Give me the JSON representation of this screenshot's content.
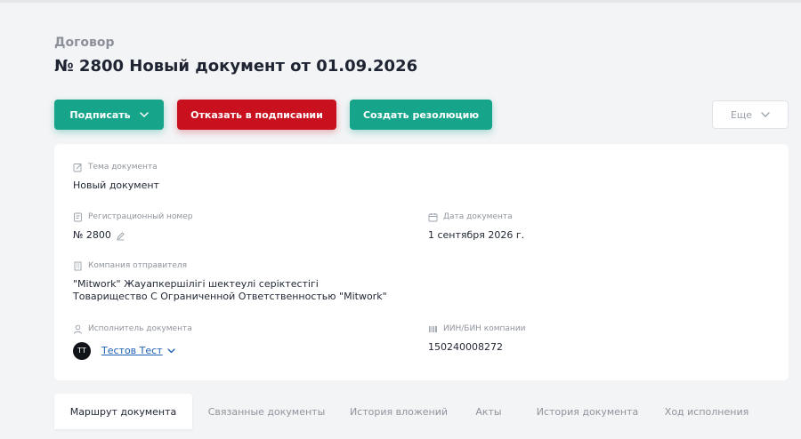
{
  "header": {
    "doc_type": "Договор",
    "title": "№ 2800 Новый документ от 01.09.2026"
  },
  "actions": {
    "sign_label": "Подписать",
    "reject_label": "Отказать в подписании",
    "resolution_label": "Создать резолюцию",
    "more_label": "Еще"
  },
  "details": {
    "subject": {
      "label": "Тема документа",
      "value": "Новый документ",
      "icon": "edit-document-icon"
    },
    "reg_number": {
      "label": "Регистрационный номер",
      "value": "№ 2800",
      "icon": "reg-number-icon"
    },
    "doc_date": {
      "label": "Дата документа",
      "value": "1 сентября 2026 г.",
      "icon": "calendar-icon"
    },
    "sender": {
      "label": "Компания отправителя",
      "value_line1": "\"Mitwork\" Жауапкершілігі шектеулі серіктестігі",
      "value_line2": "Товарищество С Ограниченной Ответственностью \"Mitwork\"",
      "icon": "building-icon"
    },
    "executor": {
      "label": "Исполнитель документа",
      "avatar_initials": "ТТ",
      "name": "Тестов Тест",
      "icon": "user-icon"
    },
    "bin": {
      "label": "ИИН/БИН компании",
      "value": "150240008272",
      "icon": "barcode-icon"
    }
  },
  "tabs": [
    {
      "label": "Маршрут документа",
      "active": true
    },
    {
      "label": "Связанные документы",
      "active": false
    },
    {
      "label": "История вложений",
      "active": false
    },
    {
      "label": "Акты",
      "active": false
    },
    {
      "label": "История документа",
      "active": false
    },
    {
      "label": "Ход исполнения",
      "active": false
    }
  ],
  "colors": {
    "primary_green": "#16a58b",
    "danger_red": "#c8101e",
    "link_blue": "#1d5fb4",
    "background": "#f3f4f6"
  }
}
